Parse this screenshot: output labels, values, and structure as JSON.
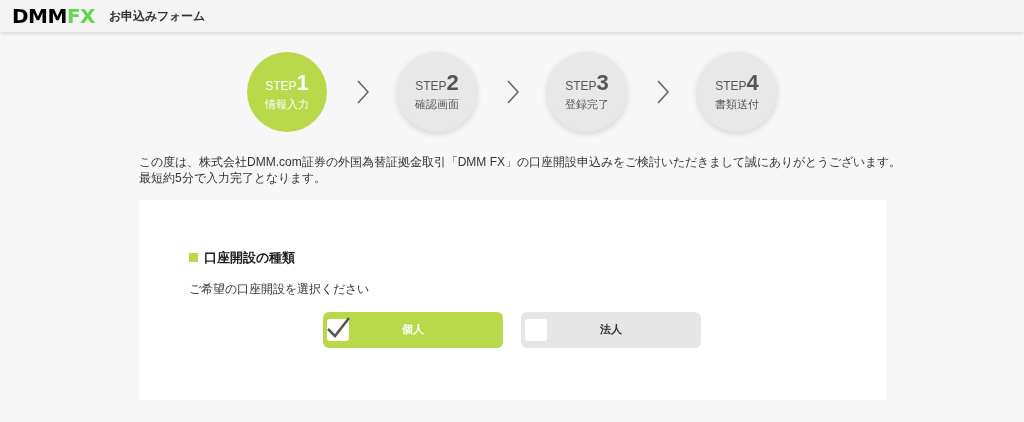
{
  "header": {
    "logo": [
      "DMM",
      "FX"
    ],
    "title": "お申込みフォーム"
  },
  "steps": [
    {
      "prefix": "STEP",
      "number": "1",
      "label": "情報入力",
      "selected": true
    },
    {
      "prefix": "STEP",
      "number": "2",
      "label": "確認画面",
      "selected": false
    },
    {
      "prefix": "STEP",
      "number": "3",
      "label": "登録完了",
      "selected": false
    },
    {
      "prefix": "STEP",
      "number": "4",
      "label": "書類送付",
      "selected": false
    }
  ],
  "intro": [
    "この度は、株式会社DMM.com証券の外国為替証拠金取引「DMM FX」の口座開設申込みをご検討いただきまして誠にありがとうございます。",
    "最短約5分で入力完了となります。"
  ],
  "section": {
    "heading": "口座開設の種類",
    "instruction": "ご希望の口座開設を選択ください",
    "options": [
      {
        "label": "個人",
        "checked": true
      },
      {
        "label": "法人",
        "checked": false
      }
    ]
  }
}
